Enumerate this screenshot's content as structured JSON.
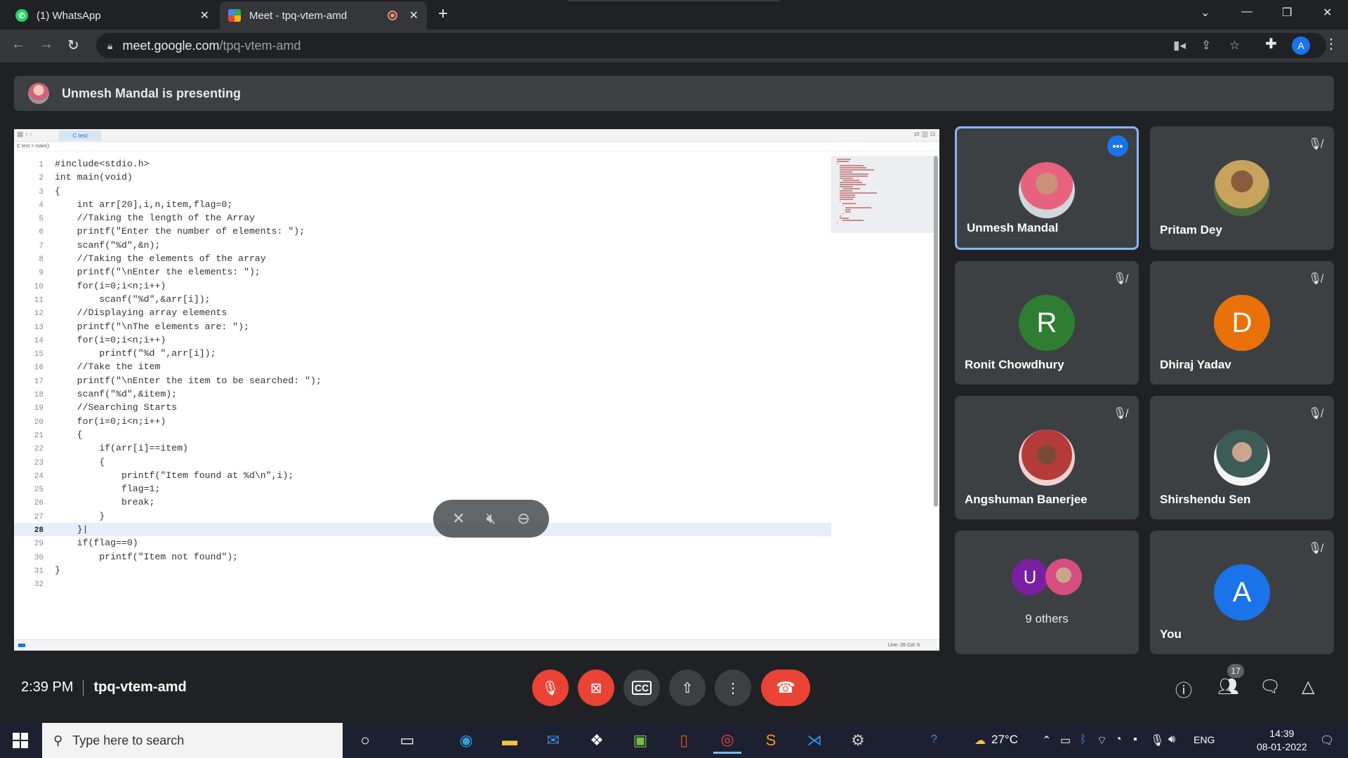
{
  "browser": {
    "tabs": [
      {
        "title": "(1) WhatsApp",
        "icon": "whatsapp-icon"
      },
      {
        "title": "Meet - tpq-vtem-amd",
        "icon": "google-meet-icon",
        "recording": true
      }
    ],
    "url_host": "meet.google.com",
    "url_path": "/tpq-vtem-amd",
    "profile_initial": "A"
  },
  "meet": {
    "banner_text": "Unmesh Mandal is presenting",
    "time": "2:39 PM",
    "meeting_code": "tpq-vtem-amd",
    "participant_count": "17",
    "participants": [
      {
        "name": "Unmesh Mandal",
        "avatar": "photo",
        "speaking": true
      },
      {
        "name": "Pritam Dey",
        "avatar": "photo",
        "muted": true
      },
      {
        "name": "Ronit Chowdhury",
        "initial": "R",
        "color": "#2e7d32",
        "muted": true
      },
      {
        "name": "Dhiraj Yadav",
        "initial": "D",
        "color": "#e8710a",
        "muted": true
      },
      {
        "name": "Angshuman Banerjee",
        "avatar": "photo",
        "muted": true
      },
      {
        "name": "Shirshendu Sen",
        "avatar": "photo",
        "muted": true
      },
      {
        "name": "9 others",
        "initial": "U",
        "color": "#7b1fa2"
      },
      {
        "name": "You",
        "initial": "A",
        "color": "#1a73e8",
        "muted": true
      }
    ]
  },
  "ide": {
    "tab_label": "C test",
    "breadcrumb": "C test  >  main()",
    "status": "Line: 28  Col: 6",
    "lines": [
      "#include<stdio.h>",
      "int main(void)",
      "{",
      "    int arr[20],i,n,item,flag=0;",
      "    //Taking the length of the Array",
      "    printf(\"Enter the number of elements: \");",
      "    scanf(\"%d\",&n);",
      "    //Taking the elements of the array",
      "    printf(\"\\nEnter the elements: \");",
      "    for(i=0;i<n;i++)",
      "        scanf(\"%d\",&arr[i]);",
      "    //Displaying array elements",
      "    printf(\"\\nThe elements are: \");",
      "    for(i=0;i<n;i++)",
      "        printf(\"%d \",arr[i]);",
      "    //Take the item",
      "    printf(\"\\nEnter the item to be searched: \");",
      "    scanf(\"%d\",&item);",
      "    //Searching Starts",
      "    for(i=0;i<n;i++)",
      "    {",
      "        if(arr[i]==item)",
      "        {",
      "            printf(\"Item found at %d\\n\",i);",
      "            flag=1;",
      "            break;",
      "        }",
      "    }|",
      "    if(flag==0)",
      "        printf(\"Item not found\");",
      "}",
      ""
    ],
    "active_line": 28
  },
  "taskbar": {
    "search_placeholder": "Type here to search",
    "temperature": "27°C",
    "language": "ENG",
    "time": "14:39",
    "date": "08-01-2022"
  },
  "colors": {
    "accent": "#1a73e8",
    "danger": "#ea4335",
    "tile_bg": "#3c4043",
    "active_tile_border": "#8ab4f8"
  }
}
